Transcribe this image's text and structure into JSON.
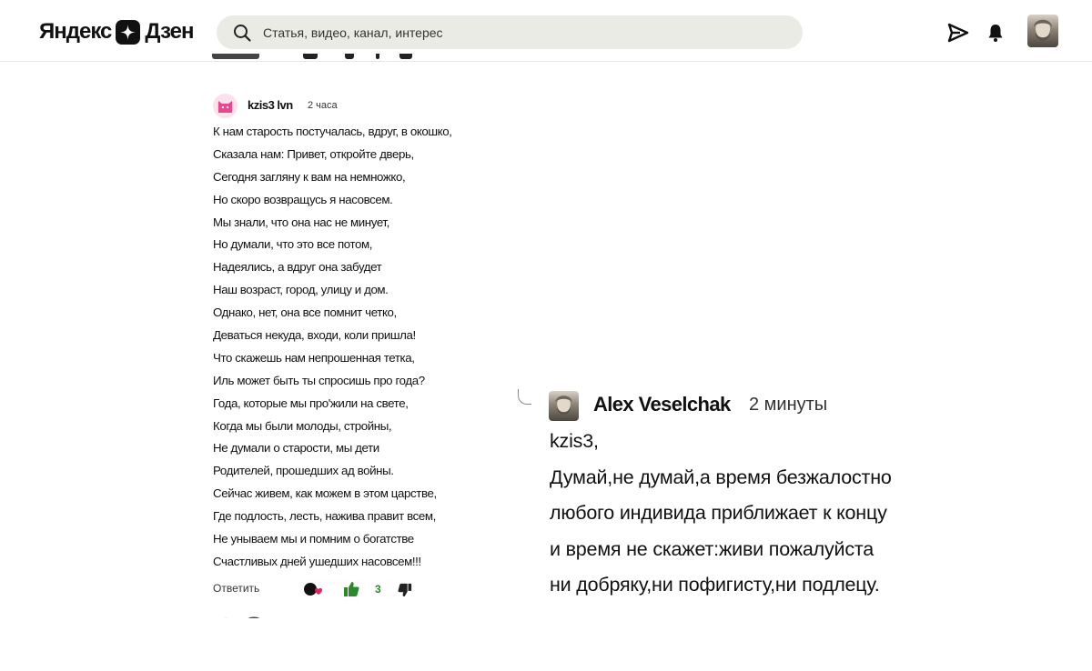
{
  "header": {
    "logo_left": "Яндекс",
    "logo_right": "Дзен",
    "search_placeholder": "Статья, видео, канал, интерес"
  },
  "comment": {
    "author": "kzis3 lvn",
    "time": "2 часа",
    "lines": [
      "К нам старость постучалась, вдруг, в окошко,",
      "Сказала нам: Привет, откройте дверь,",
      "Сегодня загляну к вам на немножко,",
      "Но скоро возвращусь я насовсем.",
      "Мы знали, что она нас не минует,",
      "Но думали, что это все потом,",
      "Надеялись, а вдруг она забудет",
      "Наш возраст, город, улицу и дом.",
      "Однако, нет, она все помнит четко,",
      "Деваться некуда, входи, коли пришла!",
      "Что скажешь нам непрошенная тетка,",
      "Иль может быть ты спросишь про года?",
      "Года, которые мы про'жили на свете,",
      "Когда мы были молоды, стройны,",
      "Не думали о старости, мы дети",
      "Родителей, прошедших ад войны.",
      "Сейчас живем, как можем в этом царстве,",
      "Где подлость, лесть, нажива правит всем,",
      "Не унываем мы и помним о богатстве",
      "Счастливых дней ушедших насовсем!!!"
    ],
    "reply_label": "Ответить",
    "like_count": "3"
  },
  "reply": {
    "author": "Alex Veselchak",
    "time": "2 минуты",
    "lines": [
      "kzis3,",
      "Думай,не думай,а время безжалостно",
      "любого индивида приближает к концу",
      "и время не скажет:живи пожалуйста",
      "ни добряку,ни пофигисту,ни подлецу."
    ]
  },
  "icons": {
    "logo": "star-icon",
    "search": "search-icon",
    "share": "paper-plane-icon",
    "notifications": "bell-icon",
    "reactions": "reactions-icon",
    "like": "thumbs-up-icon",
    "dislike": "thumbs-down-icon"
  },
  "colors": {
    "like": "#2a8a2a",
    "reaction_heart": "#e0245e",
    "search_bg": "#ebebe6"
  }
}
